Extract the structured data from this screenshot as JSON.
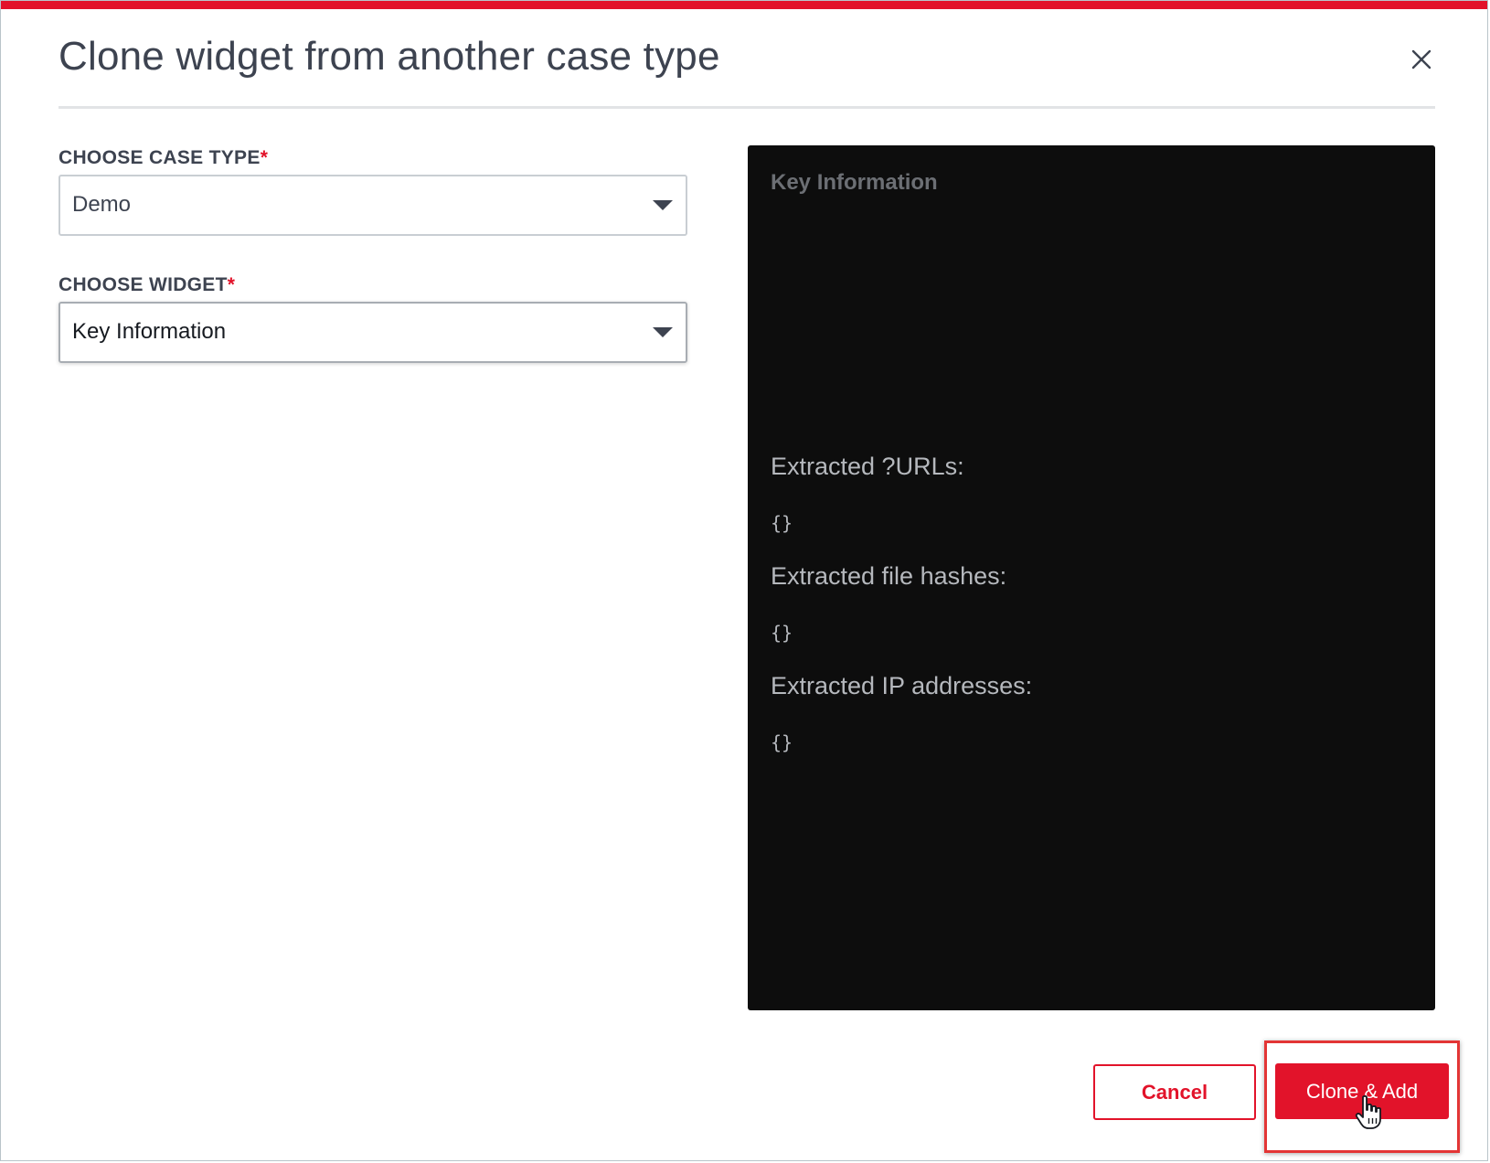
{
  "dialog": {
    "title": "Clone widget from another case type",
    "close_icon": "close-icon"
  },
  "form": {
    "case_type": {
      "label": "CHOOSE CASE TYPE",
      "required_marker": "*",
      "value": "Demo"
    },
    "widget": {
      "label": "CHOOSE WIDGET",
      "required_marker": "*",
      "value": "Key Information"
    }
  },
  "preview": {
    "title": "Key Information",
    "sections": [
      {
        "heading": "Extracted ?URLs:",
        "value": "{}"
      },
      {
        "heading": "Extracted file hashes:",
        "value": "{}"
      },
      {
        "heading": "Extracted IP addresses:",
        "value": "{}"
      }
    ]
  },
  "footer": {
    "cancel_label": "Cancel",
    "clone_label": "Clone & Add"
  },
  "colors": {
    "accent": "#e2132a",
    "preview_background": "#0d0d0d",
    "text": "#3d4350"
  }
}
